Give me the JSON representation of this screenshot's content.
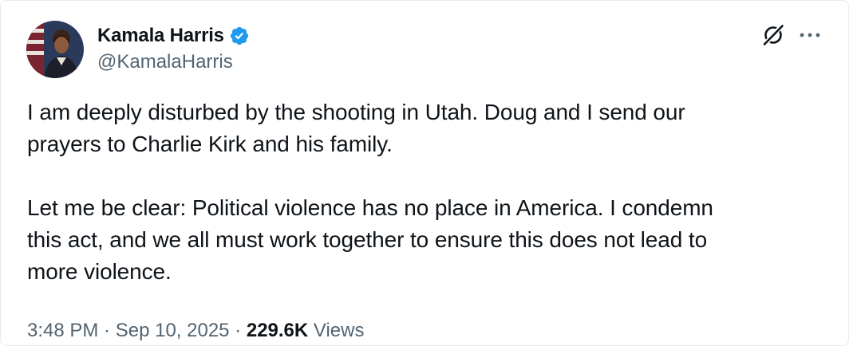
{
  "author": {
    "display_name": "Kamala Harris",
    "handle": "@KamalaHarris",
    "verified": true
  },
  "icons": {
    "avatar": "profile-photo",
    "verified": "verified-badge-icon",
    "grok": "grok-icon",
    "more": "more-options-icon"
  },
  "tweet": {
    "text": "I am deeply disturbed by the shooting in Utah. Doug and I send our\nprayers to Charlie Kirk and his family.\n\nLet me be clear: Political violence has no place in America. I condemn\nthis act, and we all must work together to ensure this does not lead to\nmore violence."
  },
  "meta": {
    "time": "3:48 PM",
    "separator": " · ",
    "date": "Sep 10, 2025",
    "views_count": "229.6K",
    "views_label": " Views"
  },
  "colors": {
    "text": "#0f1419",
    "secondary": "#536471",
    "verified_blue": "#1d9bf0",
    "border": "#e6ecf0"
  }
}
